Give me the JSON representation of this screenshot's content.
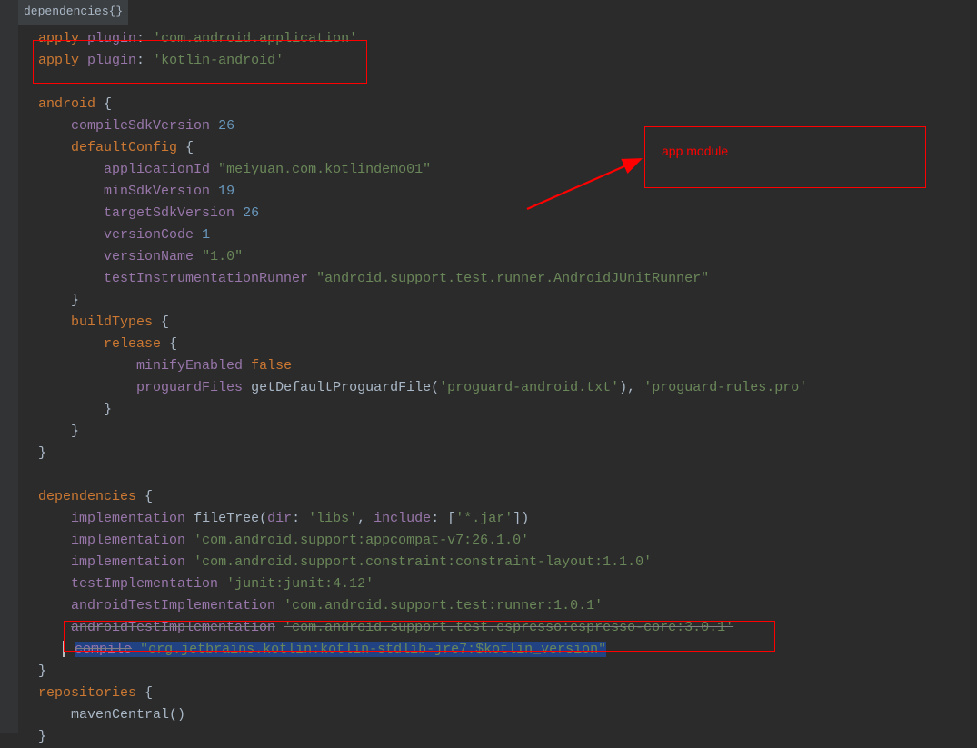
{
  "breadcrumb": "dependencies{}",
  "annotation": {
    "label": "app module"
  },
  "code": {
    "l1_apply": "apply",
    "l1_plugin": "plugin",
    "l1_colon": ":",
    "l1_str": "'com.android.application'",
    "l2_apply": "apply",
    "l2_plugin": "plugin",
    "l2_colon": ":",
    "l2_str": "'kotlin-android'",
    "l4_android": "android",
    "l4_brace": " {",
    "l5_compileSdk": "compileSdkVersion",
    "l5_num": "26",
    "l6_defaultConfig": "defaultConfig",
    "l6_brace": " {",
    "l7_appId": "applicationId",
    "l7_str": "\"meiyuan.com.kotlindemo01\"",
    "l8_minSdk": "minSdkVersion",
    "l8_num": "19",
    "l9_targetSdk": "targetSdkVersion",
    "l9_num": "26",
    "l10_versionCode": "versionCode",
    "l10_num": "1",
    "l11_versionName": "versionName",
    "l11_str": "\"1.0\"",
    "l12_testRunner": "testInstrumentationRunner",
    "l12_str": "\"android.support.test.runner.AndroidJUnitRunner\"",
    "l13_brace": "}",
    "l14_buildTypes": "buildTypes",
    "l14_brace": " {",
    "l15_release": "release",
    "l15_brace": " {",
    "l16_minify": "minifyEnabled",
    "l16_false": "false",
    "l17_proguard": "proguardFiles",
    "l17_getDef": "getDefaultProguardFile(",
    "l17_str1": "'proguard-android.txt'",
    "l17_close": "),",
    "l17_str2": "'proguard-rules.pro'",
    "l18_brace": "}",
    "l19_brace": "}",
    "l20_brace": "}",
    "l22_deps": "dependencies",
    "l22_brace": " {",
    "l23_impl": "implementation",
    "l23_fileTree": "fileTree(",
    "l23_dir": "dir",
    "l23_colon1": ":",
    "l23_str1": "'libs'",
    "l23_comma": ",",
    "l23_include": "include",
    "l23_colon2": ":",
    "l23_arr": "[",
    "l23_str2": "'*.jar'",
    "l23_arrc": "])",
    "l24_impl": "implementation",
    "l24_str": "'com.android.support:appcompat-v7:26.1.0'",
    "l25_impl": "implementation",
    "l25_str": "'com.android.support.constraint:constraint-layout:1.1.0'",
    "l26_test": "testImplementation",
    "l26_str": "'junit:junit:4.12'",
    "l27_atest": "androidTestImplementation",
    "l27_str": "'com.android.support.test:runner:1.0.1'",
    "l28_atest": "androidTestImplementation",
    "l28_str": "'com.android.support.test.espresso:espresso-core:3.0.1'",
    "l29_compile": "compile",
    "l29_str": "\"org.jetbrains.kotlin:kotlin-stdlib-jre7:$kotlin_version\"",
    "l30_brace": "}",
    "l31_repos": "repositories",
    "l31_brace": " {",
    "l32_maven": "mavenCentral()",
    "l33_brace": "}"
  }
}
